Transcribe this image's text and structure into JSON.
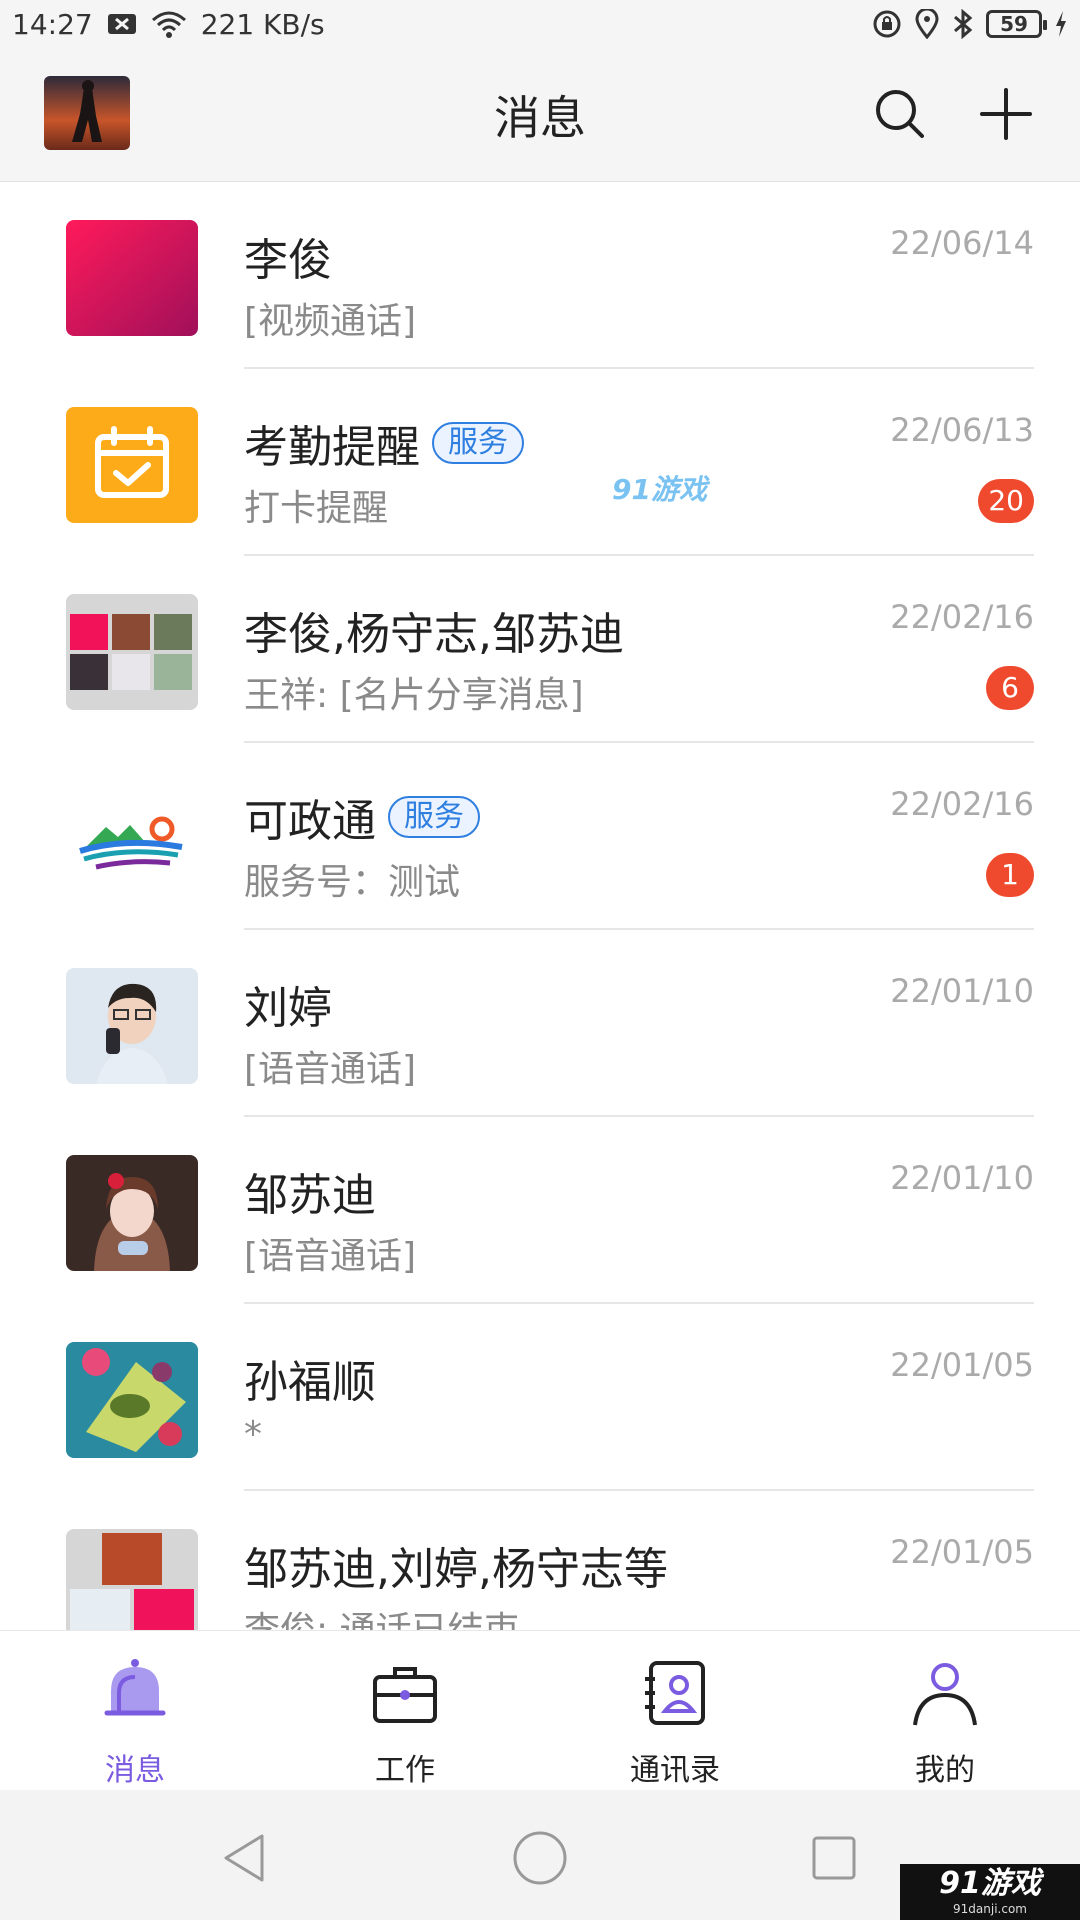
{
  "status_bar": {
    "time": "14:27",
    "speed": "221 KB/s",
    "battery": "59",
    "icons": [
      "notification-icon",
      "wifi-icon",
      "lock-rotate-icon",
      "location-icon",
      "bluetooth-icon",
      "battery-icon",
      "charging-icon"
    ]
  },
  "header": {
    "title": "消息",
    "icons": [
      "avatar",
      "search-icon",
      "plus-icon"
    ]
  },
  "conversations": [
    {
      "name": "李俊",
      "tag": "",
      "preview": "[视频通话]",
      "date": "22/06/14",
      "badge": ""
    },
    {
      "name": "考勤提醒",
      "tag": "服务",
      "preview": "打卡提醒",
      "date": "22/06/13",
      "badge": "20"
    },
    {
      "name": "李俊,杨守志,邹苏迪",
      "tag": "",
      "preview": "王祥: [名片分享消息]",
      "date": "22/02/16",
      "badge": "6"
    },
    {
      "name": "可政通",
      "tag": "服务",
      "preview": "服务号：测试",
      "date": "22/02/16",
      "badge": "1"
    },
    {
      "name": "刘婷",
      "tag": "",
      "preview": "[语音通话]",
      "date": "22/01/10",
      "badge": ""
    },
    {
      "name": "邹苏迪",
      "tag": "",
      "preview": "[语音通话]",
      "date": "22/01/10",
      "badge": ""
    },
    {
      "name": "孙福顺",
      "tag": "",
      "preview": "*",
      "date": "22/01/05",
      "badge": ""
    },
    {
      "name": "邹苏迪,刘婷,杨守志等",
      "tag": "",
      "preview": "李俊: 通话已结束",
      "date": "22/01/05",
      "badge": ""
    }
  ],
  "watermark": {
    "mid": "91游戏",
    "corner": "91游戏",
    "corner_sub": "91danji.com"
  },
  "bottom_nav": [
    {
      "label": "消息",
      "icon": "bell-icon",
      "active": true
    },
    {
      "label": "工作",
      "icon": "briefcase-icon",
      "active": false
    },
    {
      "label": "通讯录",
      "icon": "contacts-icon",
      "active": false
    },
    {
      "label": "我的",
      "icon": "profile-icon",
      "active": false
    }
  ],
  "colors": {
    "accent": "#7b5ce0",
    "badge": "#f04a2e",
    "tag": "#2f7fe0",
    "date": "#aaaaaa"
  }
}
